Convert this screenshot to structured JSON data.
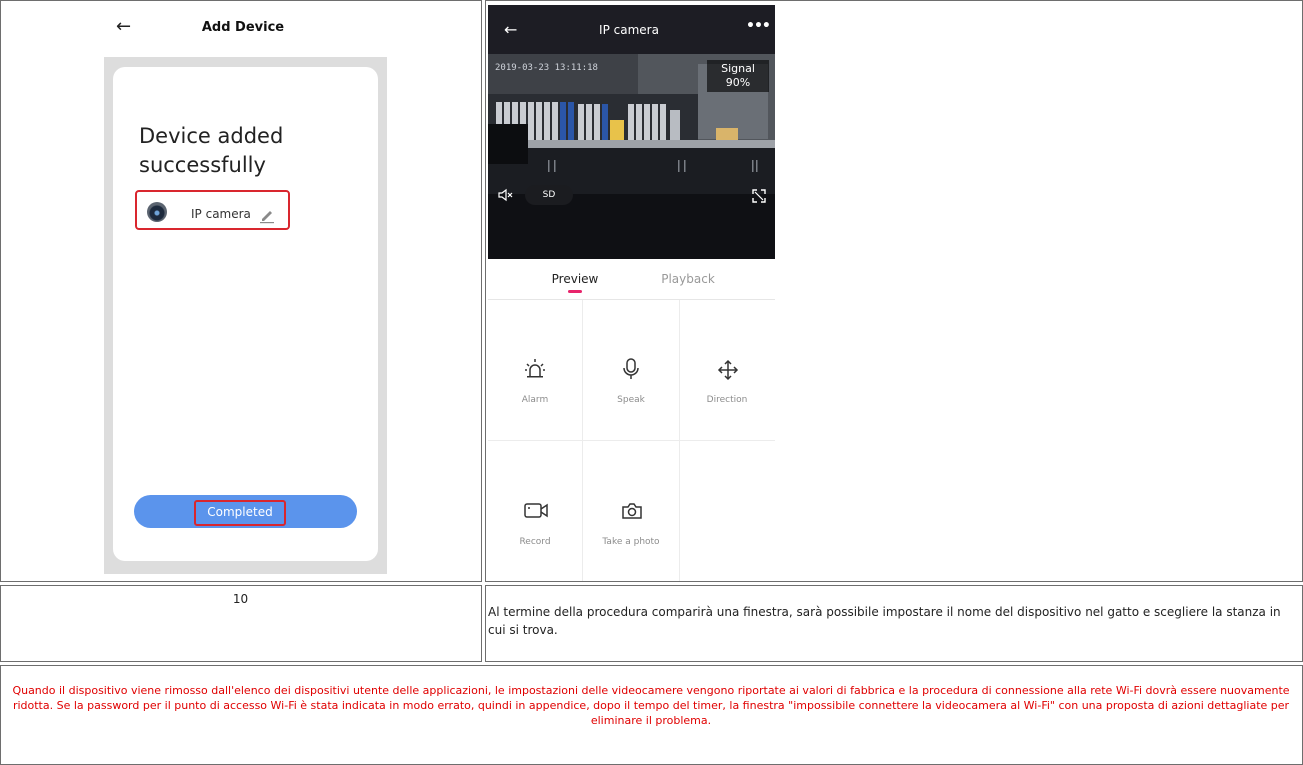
{
  "add_device_screen": {
    "title": "Add Device",
    "back_icon": "arrow-left-icon",
    "success_message": "Device added successfully",
    "device_name": "IP camera",
    "edit_icon": "pencil-icon",
    "completed_label": "Completed",
    "colors": {
      "button": "#5b94ec",
      "highlight": "#d9262e"
    }
  },
  "camera_screen": {
    "title": "IP camera",
    "back_icon": "arrow-left-icon",
    "more_icon": "more-dots-icon",
    "timestamp": "2019-03-23 13:11:18",
    "signal": {
      "label": "Signal",
      "value": "90%"
    },
    "quality": "SD",
    "mute_icon": "speaker-mute-icon",
    "fullscreen_icon": "fullscreen-icon",
    "tabs": [
      {
        "label": "Preview",
        "active": true
      },
      {
        "label": "Playback",
        "active": false
      }
    ],
    "controls": [
      {
        "label": "Alarm",
        "icon": "alarm-icon"
      },
      {
        "label": "Speak",
        "icon": "microphone-icon"
      },
      {
        "label": "Direction",
        "icon": "direction-arrows-icon"
      },
      {
        "label": "Record",
        "icon": "video-record-icon"
      },
      {
        "label": "Take a photo",
        "icon": "camera-icon"
      }
    ],
    "colors": {
      "header": "#1d1d24",
      "accent": "#e8246b"
    }
  },
  "step": {
    "number": "10",
    "description": "Al termine della procedura comparirà una finestra, sarà possibile impostare il nome del dispositivo nel gatto e scegliere la stanza in cui si trova."
  },
  "note": {
    "text": "Quando il dispositivo viene rimosso dall'elenco dei dispositivi utente delle applicazioni, le impostazioni delle videocamere vengono riportate ai valori di fabbrica e la procedura di connessione alla rete Wi-Fi dovrà essere nuovamente ridotta. Se la password per il punto di accesso Wi-Fi è stata indicata in modo errato, quindi in appendice, dopo il tempo del timer, la finestra \"impossibile connettere la videocamera al Wi-Fi\" con una proposta di azioni dettagliate per eliminare il problema.",
    "color": "#e00000"
  }
}
